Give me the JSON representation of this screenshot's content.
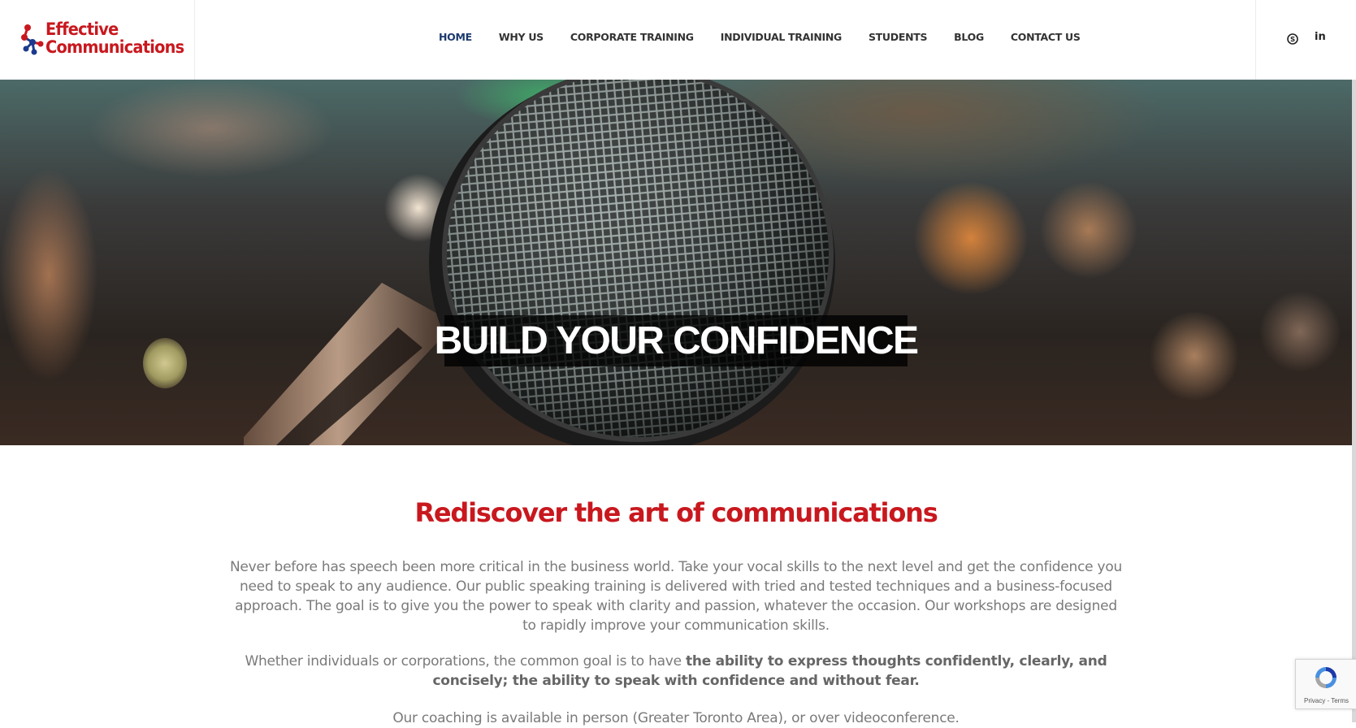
{
  "header": {
    "logo": {
      "line1": "Effective",
      "line2": "Communications"
    },
    "nav": [
      {
        "label": "HOME",
        "active": true
      },
      {
        "label": "WHY US"
      },
      {
        "label": "CORPORATE TRAINING"
      },
      {
        "label": "INDIVIDUAL TRAINING"
      },
      {
        "label": "STUDENTS"
      },
      {
        "label": "BLOG"
      },
      {
        "label": "CONTACT US"
      }
    ],
    "social": [
      {
        "icon": "skype-icon",
        "glyph": "⊜"
      },
      {
        "icon": "linkedin-icon",
        "glyph": "in"
      }
    ]
  },
  "hero": {
    "title": "BUILD YOUR CONFIDENCE"
  },
  "content": {
    "heading": "Rediscover the art of communications",
    "p1": "Never before has speech been more critical in the business world. Take your vocal skills to the next level and get the confidence you need to speak to any audience. Our public speaking training is delivered with tried and tested techniques and a business-focused approach. The goal is to give you the power to speak with clarity and passion, whatever the occasion. Our workshops are designed to rapidly improve your communication skills.",
    "p2_plain": "Whether individuals or corporations, the common goal is to have ",
    "p2_bold": "the ability to express thoughts confidently, clearly, and concisely; the ability to speak with confidence and without fear.",
    "p3": "Our coaching is available in person (Greater Toronto Area), or over videoconference."
  },
  "recaptcha": {
    "links": "Privacy - Terms"
  },
  "colors": {
    "brand_red": "#c8181e",
    "nav_active": "#1c3a6e",
    "logo_blue": "#1c3a8e"
  }
}
